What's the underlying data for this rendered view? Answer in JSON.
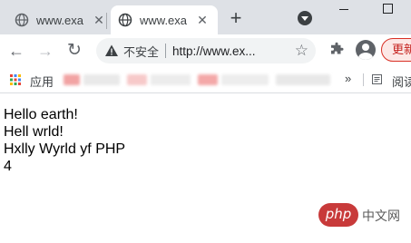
{
  "tabs": [
    {
      "title": "www.exa",
      "active": false
    },
    {
      "title": "www.exa",
      "active": true
    }
  ],
  "toolbar": {
    "security_label": "不安全",
    "url": "http://www.ex...",
    "update_label": "更新"
  },
  "bookmarks": {
    "apps_label": "应用",
    "more_label": "»",
    "reading_list_label": "阅读"
  },
  "content": {
    "lines": [
      "Hello earth!",
      "Hell wrld!",
      "Hxlly Wyrld yf PHP",
      "4"
    ]
  },
  "watermark": {
    "logo_text": "php",
    "site_text": "中文网"
  },
  "colors": {
    "tabstrip_bg": "#dee1e6",
    "update_accent": "#d93025",
    "watermark_red": "#c83a3a"
  }
}
